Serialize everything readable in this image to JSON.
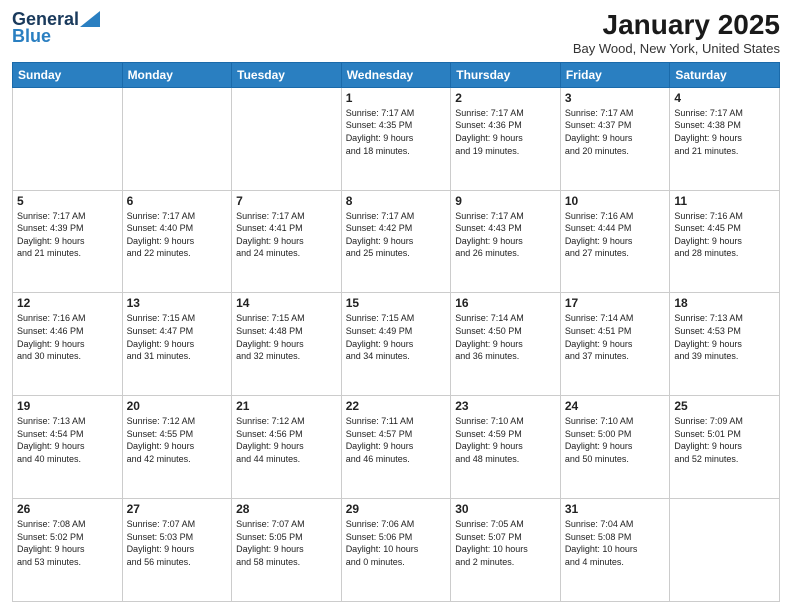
{
  "header": {
    "logo_general": "General",
    "logo_blue": "Blue",
    "month_title": "January 2025",
    "location": "Bay Wood, New York, United States"
  },
  "days_of_week": [
    "Sunday",
    "Monday",
    "Tuesday",
    "Wednesday",
    "Thursday",
    "Friday",
    "Saturday"
  ],
  "weeks": [
    [
      {
        "day": "",
        "info": ""
      },
      {
        "day": "",
        "info": ""
      },
      {
        "day": "",
        "info": ""
      },
      {
        "day": "1",
        "info": "Sunrise: 7:17 AM\nSunset: 4:35 PM\nDaylight: 9 hours\nand 18 minutes."
      },
      {
        "day": "2",
        "info": "Sunrise: 7:17 AM\nSunset: 4:36 PM\nDaylight: 9 hours\nand 19 minutes."
      },
      {
        "day": "3",
        "info": "Sunrise: 7:17 AM\nSunset: 4:37 PM\nDaylight: 9 hours\nand 20 minutes."
      },
      {
        "day": "4",
        "info": "Sunrise: 7:17 AM\nSunset: 4:38 PM\nDaylight: 9 hours\nand 21 minutes."
      }
    ],
    [
      {
        "day": "5",
        "info": "Sunrise: 7:17 AM\nSunset: 4:39 PM\nDaylight: 9 hours\nand 21 minutes."
      },
      {
        "day": "6",
        "info": "Sunrise: 7:17 AM\nSunset: 4:40 PM\nDaylight: 9 hours\nand 22 minutes."
      },
      {
        "day": "7",
        "info": "Sunrise: 7:17 AM\nSunset: 4:41 PM\nDaylight: 9 hours\nand 24 minutes."
      },
      {
        "day": "8",
        "info": "Sunrise: 7:17 AM\nSunset: 4:42 PM\nDaylight: 9 hours\nand 25 minutes."
      },
      {
        "day": "9",
        "info": "Sunrise: 7:17 AM\nSunset: 4:43 PM\nDaylight: 9 hours\nand 26 minutes."
      },
      {
        "day": "10",
        "info": "Sunrise: 7:16 AM\nSunset: 4:44 PM\nDaylight: 9 hours\nand 27 minutes."
      },
      {
        "day": "11",
        "info": "Sunrise: 7:16 AM\nSunset: 4:45 PM\nDaylight: 9 hours\nand 28 minutes."
      }
    ],
    [
      {
        "day": "12",
        "info": "Sunrise: 7:16 AM\nSunset: 4:46 PM\nDaylight: 9 hours\nand 30 minutes."
      },
      {
        "day": "13",
        "info": "Sunrise: 7:15 AM\nSunset: 4:47 PM\nDaylight: 9 hours\nand 31 minutes."
      },
      {
        "day": "14",
        "info": "Sunrise: 7:15 AM\nSunset: 4:48 PM\nDaylight: 9 hours\nand 32 minutes."
      },
      {
        "day": "15",
        "info": "Sunrise: 7:15 AM\nSunset: 4:49 PM\nDaylight: 9 hours\nand 34 minutes."
      },
      {
        "day": "16",
        "info": "Sunrise: 7:14 AM\nSunset: 4:50 PM\nDaylight: 9 hours\nand 36 minutes."
      },
      {
        "day": "17",
        "info": "Sunrise: 7:14 AM\nSunset: 4:51 PM\nDaylight: 9 hours\nand 37 minutes."
      },
      {
        "day": "18",
        "info": "Sunrise: 7:13 AM\nSunset: 4:53 PM\nDaylight: 9 hours\nand 39 minutes."
      }
    ],
    [
      {
        "day": "19",
        "info": "Sunrise: 7:13 AM\nSunset: 4:54 PM\nDaylight: 9 hours\nand 40 minutes."
      },
      {
        "day": "20",
        "info": "Sunrise: 7:12 AM\nSunset: 4:55 PM\nDaylight: 9 hours\nand 42 minutes."
      },
      {
        "day": "21",
        "info": "Sunrise: 7:12 AM\nSunset: 4:56 PM\nDaylight: 9 hours\nand 44 minutes."
      },
      {
        "day": "22",
        "info": "Sunrise: 7:11 AM\nSunset: 4:57 PM\nDaylight: 9 hours\nand 46 minutes."
      },
      {
        "day": "23",
        "info": "Sunrise: 7:10 AM\nSunset: 4:59 PM\nDaylight: 9 hours\nand 48 minutes."
      },
      {
        "day": "24",
        "info": "Sunrise: 7:10 AM\nSunset: 5:00 PM\nDaylight: 9 hours\nand 50 minutes."
      },
      {
        "day": "25",
        "info": "Sunrise: 7:09 AM\nSunset: 5:01 PM\nDaylight: 9 hours\nand 52 minutes."
      }
    ],
    [
      {
        "day": "26",
        "info": "Sunrise: 7:08 AM\nSunset: 5:02 PM\nDaylight: 9 hours\nand 53 minutes."
      },
      {
        "day": "27",
        "info": "Sunrise: 7:07 AM\nSunset: 5:03 PM\nDaylight: 9 hours\nand 56 minutes."
      },
      {
        "day": "28",
        "info": "Sunrise: 7:07 AM\nSunset: 5:05 PM\nDaylight: 9 hours\nand 58 minutes."
      },
      {
        "day": "29",
        "info": "Sunrise: 7:06 AM\nSunset: 5:06 PM\nDaylight: 10 hours\nand 0 minutes."
      },
      {
        "day": "30",
        "info": "Sunrise: 7:05 AM\nSunset: 5:07 PM\nDaylight: 10 hours\nand 2 minutes."
      },
      {
        "day": "31",
        "info": "Sunrise: 7:04 AM\nSunset: 5:08 PM\nDaylight: 10 hours\nand 4 minutes."
      },
      {
        "day": "",
        "info": ""
      }
    ]
  ]
}
